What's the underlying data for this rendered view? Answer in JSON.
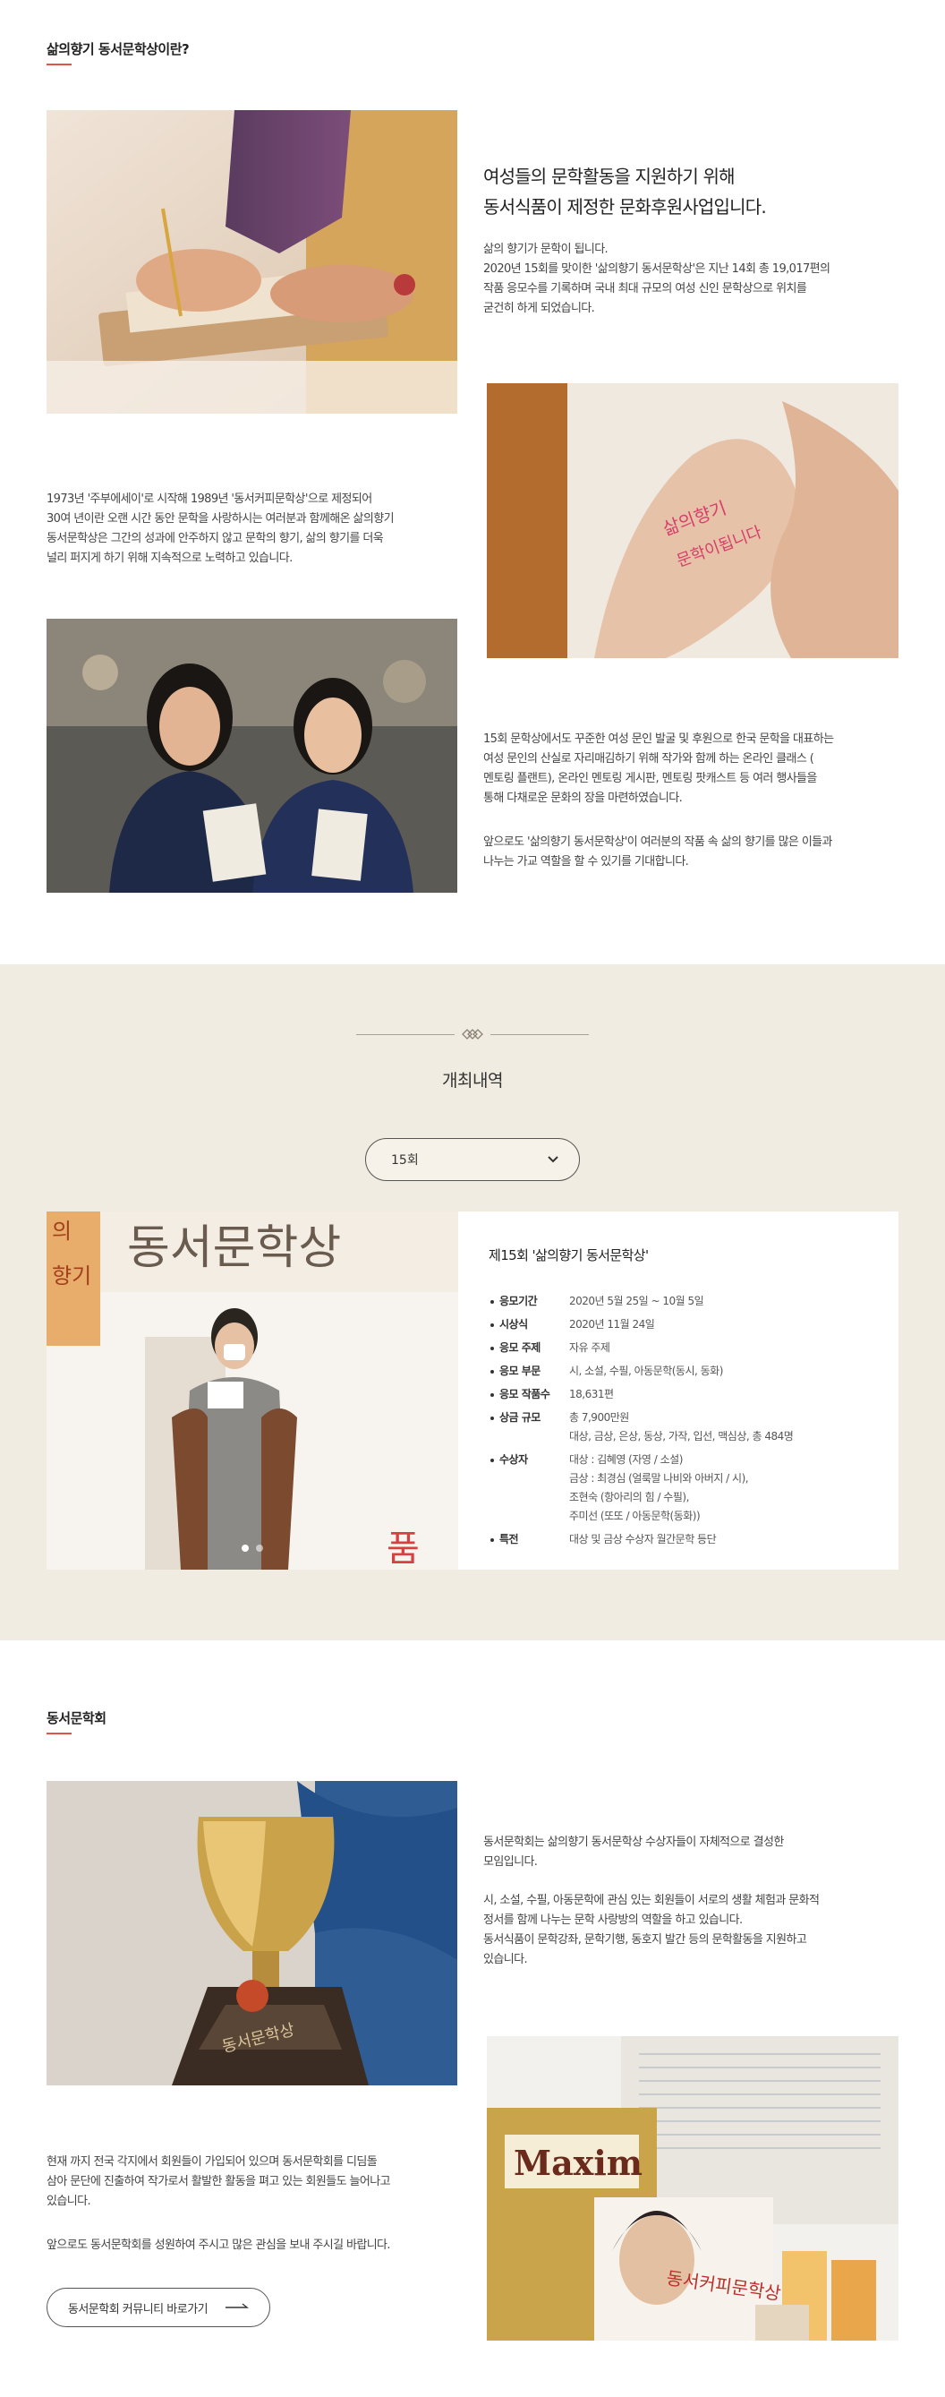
{
  "section1": {
    "title": "삶의향기 동서문학상이란?",
    "headline": [
      "여성들의 문학활동을 지원하기 위해",
      "동서식품이 제정한 문화후원사업입니다."
    ],
    "para_intro": [
      "삶의 향기가 문학이 됩니다.",
      "2020년 15회를 맞이한 '삶의향기 동서문학상'은 지난 14회 총 19,017편의",
      "작품 응모수를 기록하며 국내 최대 규모의 여성 신인 문학상으로 위치를",
      "굳건히 하게 되었습니다."
    ],
    "para_history": [
      "1973년 '주부에세이'로 시작해 1989년 '동서커피문학상'으로 제정되어",
      "30여 년이란 오랜 시간 동안 문학을 사랑하시는 여러분과 함께해온 삶의향기",
      "동서문학상은 그간의 성과에 안주하지 않고 문학의 향기, 삶의 향기를 더욱",
      "널리 퍼지게 하기 위해 지속적으로 노력하고 있습니다."
    ],
    "para_program": [
      "15회 문학상에서도 꾸준한 여성 문인 발굴 및 후원으로 한국 문학을 대표하는",
      "여성 문인의 산실로 자리매김하기 위해 작가와 함께 하는 온라인 클래스 (",
      "멘토링 플랜트), 온라인 멘토링 게시판, 멘토링 팟캐스트 등 여러 행사들을",
      "통해 다채로운 문화의 장을 마련하였습니다."
    ],
    "para_future": [
      "앞으로도 '삶의향기 동서문학상'이 여러분의 작품 속 삶의 향기를 많은 이들과",
      "나누는 가교 역할을 할 수 있기를 기대합니다."
    ]
  },
  "history": {
    "title": "개최내역",
    "select_value": "15회",
    "photo_banner": "동서문학상",
    "photo_side": [
      "의",
      "향기"
    ],
    "photo_corner": "품",
    "card_title": "제15회 '삶의향기 동서문학상'",
    "rows": [
      {
        "label": "응모기간",
        "values": [
          "2020년 5월 25일 ~ 10월 5일"
        ]
      },
      {
        "label": "시상식",
        "values": [
          "2020년 11월 24일"
        ]
      },
      {
        "label": "응모 주제",
        "values": [
          "자유 주제"
        ]
      },
      {
        "label": "응모 부문",
        "values": [
          "시, 소설, 수필, 아동문학(동시, 동화)"
        ]
      },
      {
        "label": "응모 작품수",
        "values": [
          "18,631편"
        ]
      },
      {
        "label": "상금 규모",
        "values": [
          "총 7,900만원",
          "대상, 금상, 은상, 동상, 가작, 입선, 맥심상, 총 484명"
        ]
      },
      {
        "label": "수상자",
        "values": [
          "대상 : 김혜영 (자영 / 소설)",
          "금상 : 최경심 (얼룩말 나비와 아버지 / 시),",
          "조현숙 (항아리의 힘 / 수필),",
          "주미선 (또또 / 아동문학(동화))"
        ]
      },
      {
        "label": "특전",
        "values": [
          "대상 및 금상 수상자 월간문학 등단"
        ]
      }
    ]
  },
  "section3": {
    "title": "동서문학회",
    "trophy_plate": "동서문학상",
    "para_intro": [
      "동서문학회는 삶의향기 동서문학상 수상자들이 자체적으로 결성한",
      "모임입니다."
    ],
    "para_activity": [
      "시, 소설, 수필, 아동문학에 관심 있는 회원들이 서로의 생활 체험과 문화적",
      "정서를 함께 나누는 문학 사랑방의 역할을 하고 있습니다.",
      "동서식품이 문학강좌, 문학기행, 동호지 발간 등의 문학활동을 지원하고",
      "있습니다."
    ],
    "para_members": [
      "현재 까지 전국 각지에서 회원들이 가입되어 있으며 동서문학회를 디딤돌",
      "삼아 문단에 진출하여 작가로서 활발한 활동을 펴고 있는 회원들도 늘어나고",
      "있습니다."
    ],
    "para_closing": [
      "앞으로도 동서문학회를 성원하여 주시고 많은 관심을 보내 주시길 바랍니다."
    ],
    "product_brand": "Maxim",
    "product_label": "동서커피문학상",
    "button_label": "동서문학회 커뮤니티 바로가기"
  },
  "colors": {
    "accent": "#e0554b",
    "band": "#f1ece1",
    "text": "#333333"
  }
}
